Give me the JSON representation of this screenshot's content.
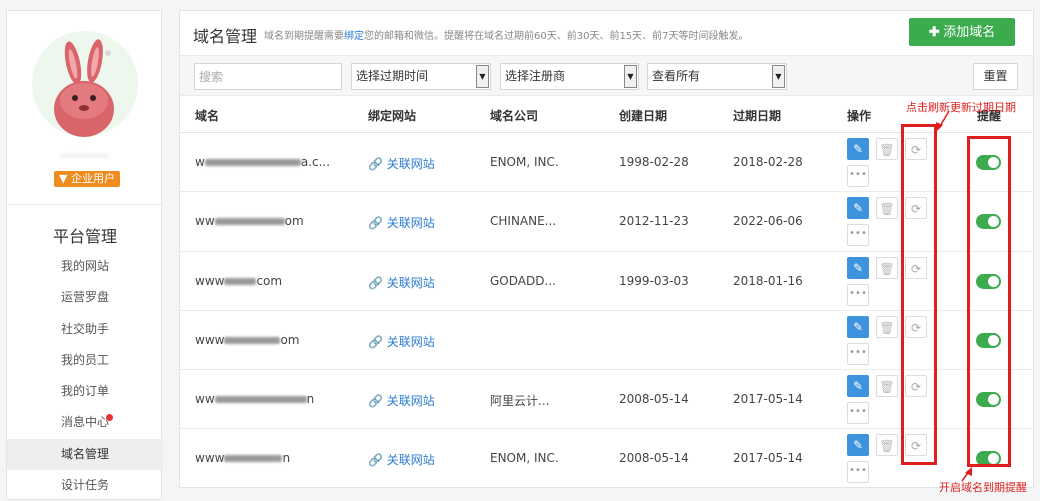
{
  "sidebar": {
    "username": "··········",
    "badge": "企业用户",
    "badge_icon": "v-icon",
    "heading": "平台管理",
    "items": [
      {
        "label": "我的网站"
      },
      {
        "label": "运营罗盘"
      },
      {
        "label": "社交助手"
      },
      {
        "label": "我的员工"
      },
      {
        "label": "我的订单"
      },
      {
        "label": "消息中心"
      },
      {
        "label": "域名管理"
      },
      {
        "label": "设计任务"
      }
    ],
    "active_item": "域名管理",
    "notification_dot_color": "#e8332f"
  },
  "header": {
    "title": "域名管理",
    "hint_prefix": "域名到期提醒需要",
    "hint_link": "绑定",
    "hint_suffix": "您的邮箱和微信。提醒将在域名过期前60天、前30天、前15天、前7天等时间段触发。",
    "add_button": "添加域名",
    "add_button_color": "#3bab4e"
  },
  "filters": {
    "search_placeholder": "搜索",
    "expiry_select": "选择过期时间",
    "registrar_select": "选择注册商",
    "view_select": "查看所有",
    "reset_button": "重置"
  },
  "table": {
    "columns": {
      "domain": "域名",
      "site": "绑定网站",
      "company": "域名公司",
      "created": "创建日期",
      "expires": "过期日期",
      "actions": "操作",
      "remind": "提醒"
    },
    "link_label": "关联网站",
    "rows": [
      {
        "domain_pre": "w",
        "domain_post": "a.c...",
        "company": "ENOM, INC.",
        "created": "1998-02-28",
        "expires": "2018-02-28",
        "remind": true
      },
      {
        "domain_pre": "ww",
        "domain_post": "om",
        "company": "CHINANE...",
        "created": "2012-11-23",
        "expires": "2022-06-06",
        "remind": true
      },
      {
        "domain_pre": "www",
        "domain_post": "com",
        "company": "GODADD...",
        "created": "1999-03-03",
        "expires": "2018-01-16",
        "remind": true
      },
      {
        "domain_pre": "www",
        "domain_post": "om",
        "company": "",
        "created": "",
        "expires": "",
        "remind": true
      },
      {
        "domain_pre": "ww",
        "domain_post": "n",
        "company": "阿里云计...",
        "created": "2008-05-14",
        "expires": "2017-05-14",
        "remind": true
      },
      {
        "domain_pre": "www",
        "domain_post": "n",
        "company": "ENOM, INC.",
        "created": "2008-05-14",
        "expires": "2017-05-14",
        "remind": true
      }
    ]
  },
  "annotations": {
    "refresh_note": "点击刷新更新过期日期",
    "remind_note": "开启域名到期提醒",
    "color": "#e01e1e"
  }
}
